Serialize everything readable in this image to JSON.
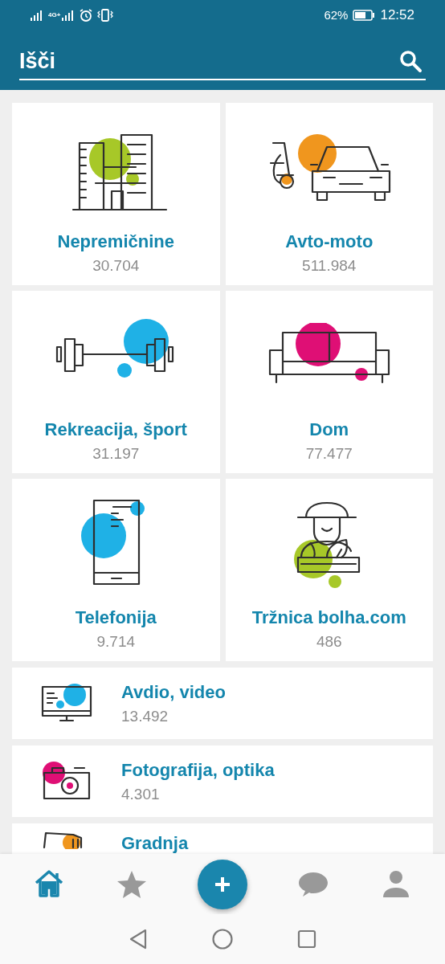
{
  "status_bar": {
    "network": "4G+",
    "battery": "62%",
    "time": "12:52"
  },
  "search": {
    "placeholder": "Išči"
  },
  "tiles": [
    {
      "title": "Nepremičnine",
      "count": "30.704"
    },
    {
      "title": "Avto-moto",
      "count": "511.984"
    },
    {
      "title": "Rekreacija, šport",
      "count": "31.197"
    },
    {
      "title": "Dom",
      "count": "77.477"
    },
    {
      "title": "Telefonija",
      "count": "9.714"
    },
    {
      "title": "Tržnica bolha.com",
      "count": "486"
    }
  ],
  "list": [
    {
      "title": "Avdio, video",
      "count": "13.492"
    },
    {
      "title": "Fotografija, optika",
      "count": "4.301"
    },
    {
      "title": "Gradnja"
    }
  ],
  "bottom_nav": [
    {
      "kind": "tab",
      "selected": true
    },
    {
      "kind": "tab",
      "selected": false
    },
    {
      "kind": "action"
    },
    {
      "kind": "tab",
      "selected": false
    },
    {
      "kind": "tab",
      "selected": false
    }
  ]
}
